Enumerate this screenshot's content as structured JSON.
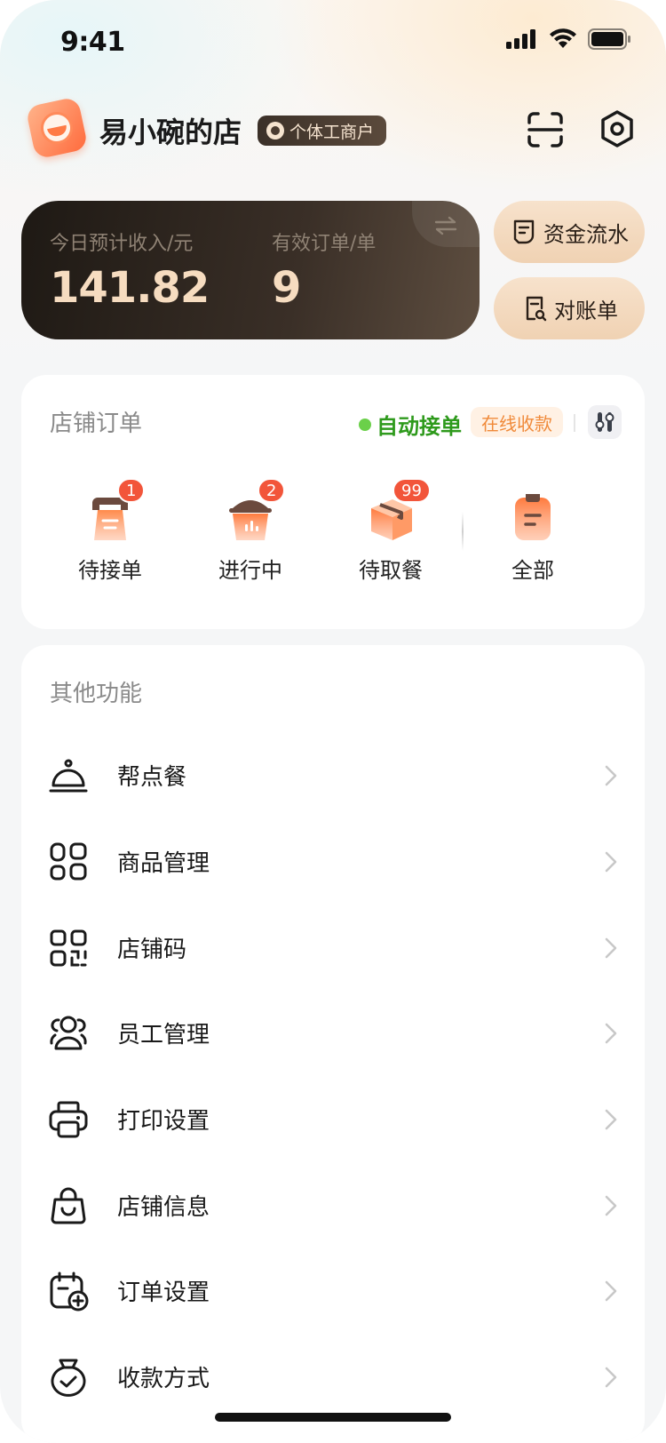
{
  "status_bar": {
    "time": "9:41"
  },
  "header": {
    "store_name": "易小碗的店",
    "badge": "个体工商户"
  },
  "income": {
    "today_income_label": "今日预计收入/元",
    "today_income_value": "141.82",
    "valid_orders_label": "有效订单/单",
    "valid_orders_value": "9"
  },
  "side_buttons": {
    "fund_flow": "资金流水",
    "reconciliation": "对账单"
  },
  "orders": {
    "title": "店铺订单",
    "auto_accept": "自动接单",
    "online_pay": "在线收款",
    "items": [
      {
        "label": "待接单",
        "badge": "1"
      },
      {
        "label": "进行中",
        "badge": "2"
      },
      {
        "label": "待取餐",
        "badge": "99"
      },
      {
        "label": "全部",
        "badge": ""
      }
    ]
  },
  "functions": {
    "title": "其他功能",
    "items": [
      {
        "label": "帮点餐",
        "icon": "service-bell-icon"
      },
      {
        "label": "商品管理",
        "icon": "grid-apps-icon"
      },
      {
        "label": "店铺码",
        "icon": "qr-code-icon"
      },
      {
        "label": "员工管理",
        "icon": "users-icon"
      },
      {
        "label": "打印设置",
        "icon": "printer-icon"
      },
      {
        "label": "店铺信息",
        "icon": "shopping-bag-icon"
      },
      {
        "label": "订单设置",
        "icon": "calendar-add-icon"
      },
      {
        "label": "收款方式",
        "icon": "money-bag-icon"
      }
    ]
  },
  "colors": {
    "accent": "#ff6b3d",
    "badge_red": "#f2553a",
    "green": "#2e9a1c",
    "gold": "#f6dcc0"
  }
}
